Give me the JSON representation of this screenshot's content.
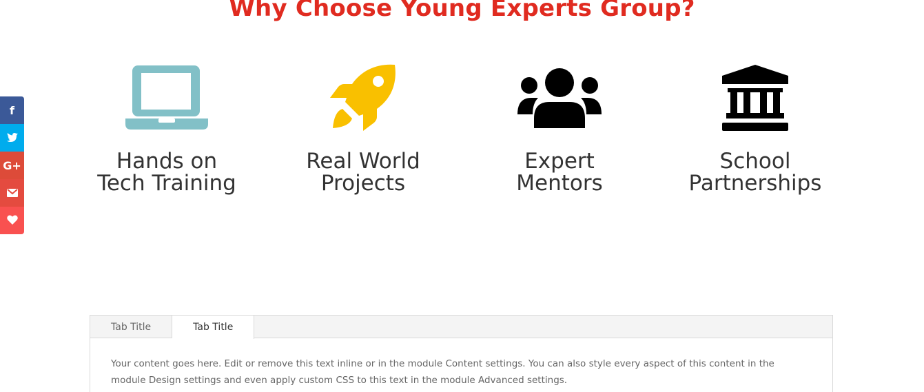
{
  "page": {
    "title": "Why Choose Young Experts Group?",
    "title_color": "#e02b20"
  },
  "features": [
    {
      "icon": "laptop-icon",
      "line1": "Hands on",
      "line2": "Tech Training",
      "color": "#82c0c7"
    },
    {
      "icon": "rocket-icon",
      "line1": "Real World",
      "line2": "Projects",
      "color": "#f9c000"
    },
    {
      "icon": "users-icon",
      "line1": "Expert",
      "line2": "Mentors",
      "color": "#000000"
    },
    {
      "icon": "institution-icon",
      "line1": "School",
      "line2": "Partnerships",
      "color": "#000000"
    }
  ],
  "share_bar": [
    {
      "icon": "facebook-icon",
      "glyph": "f",
      "color": "#3b5998"
    },
    {
      "icon": "twitter-icon",
      "glyph": "",
      "color": "#00aced"
    },
    {
      "icon": "google-plus-icon",
      "glyph": "G+",
      "color": "#dd4b39"
    },
    {
      "icon": "email-icon",
      "glyph": "",
      "color": "#e44b3f"
    },
    {
      "icon": "heart-icon",
      "glyph": "",
      "color": "#f95150"
    }
  ],
  "tabs": {
    "items": [
      {
        "label": "Tab Title",
        "active": false
      },
      {
        "label": "Tab Title",
        "active": true
      }
    ],
    "content": "Your content goes here. Edit or remove this text inline or in the module Content settings. You can also style every aspect of this content in the module Design settings and even apply custom CSS to this text in the module Advanced settings."
  }
}
